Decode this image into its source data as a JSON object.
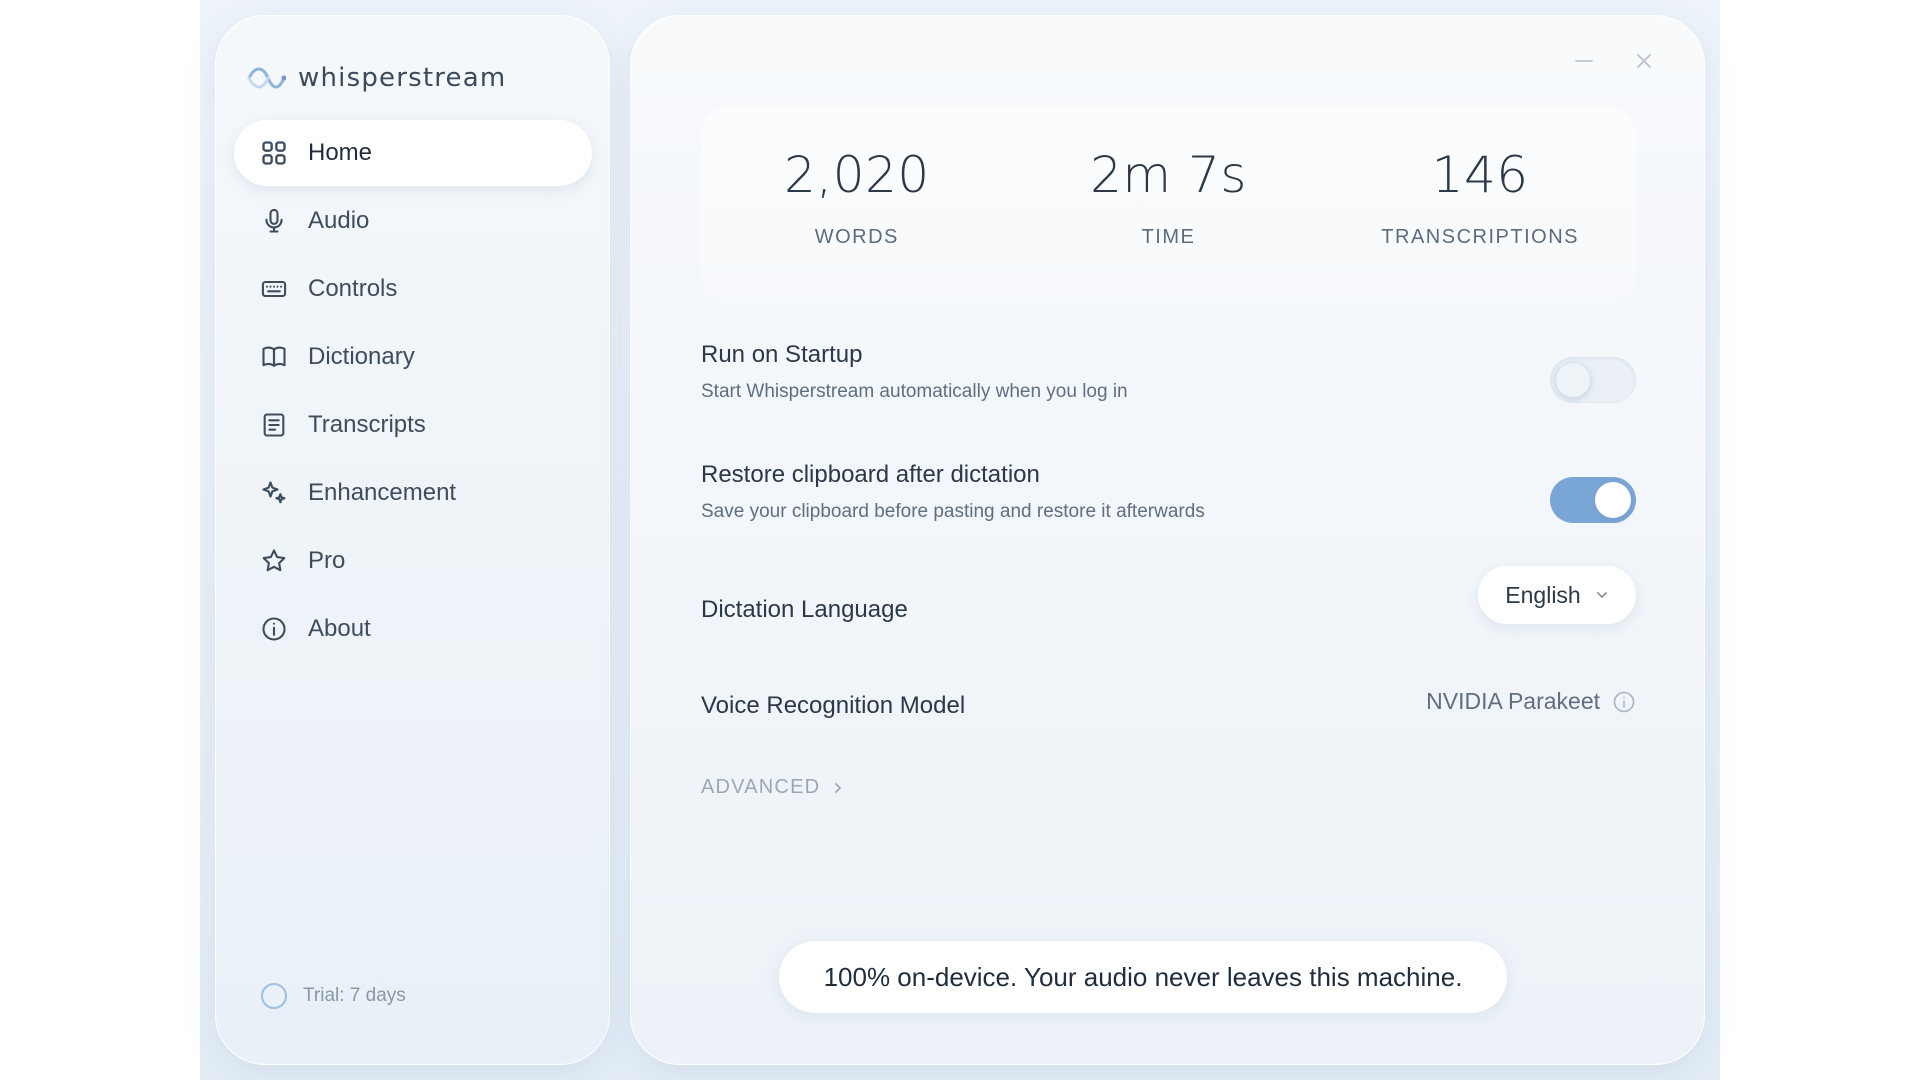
{
  "app": {
    "name": "whisperstream"
  },
  "sidebar": {
    "items": [
      {
        "label": "Home",
        "icon": "grid-icon",
        "active": true
      },
      {
        "label": "Audio",
        "icon": "microphone-icon",
        "active": false
      },
      {
        "label": "Controls",
        "icon": "keyboard-icon",
        "active": false
      },
      {
        "label": "Dictionary",
        "icon": "book-icon",
        "active": false
      },
      {
        "label": "Transcripts",
        "icon": "document-icon",
        "active": false
      },
      {
        "label": "Enhancement",
        "icon": "sparkle-icon",
        "active": false
      },
      {
        "label": "Pro",
        "icon": "star-icon",
        "active": false
      },
      {
        "label": "About",
        "icon": "info-icon",
        "active": false
      }
    ],
    "trial": "Trial: 7 days"
  },
  "stats": [
    {
      "value": "2,020",
      "label": "WORDS"
    },
    {
      "value": "2m 7s",
      "label": "TIME"
    },
    {
      "value": "146",
      "label": "TRANSCRIPTIONS"
    }
  ],
  "settings": {
    "run_on_startup": {
      "title": "Run on Startup",
      "description": "Start Whisperstream automatically when you log in",
      "enabled": false
    },
    "restore_clipboard": {
      "title": "Restore clipboard after dictation",
      "description": "Save your clipboard before pasting and restore it afterwards",
      "enabled": true
    },
    "dictation_language": {
      "title": "Dictation Language",
      "value": "English"
    },
    "voice_model": {
      "title": "Voice Recognition Model",
      "value": "NVIDIA Parakeet"
    },
    "advanced_label": "ADVANCED"
  },
  "banner": "100% on-device. Your audio never leaves this machine.",
  "colors": {
    "accent": "#7aa6d6",
    "background": "#e4edf6",
    "text": "#2a3847"
  }
}
